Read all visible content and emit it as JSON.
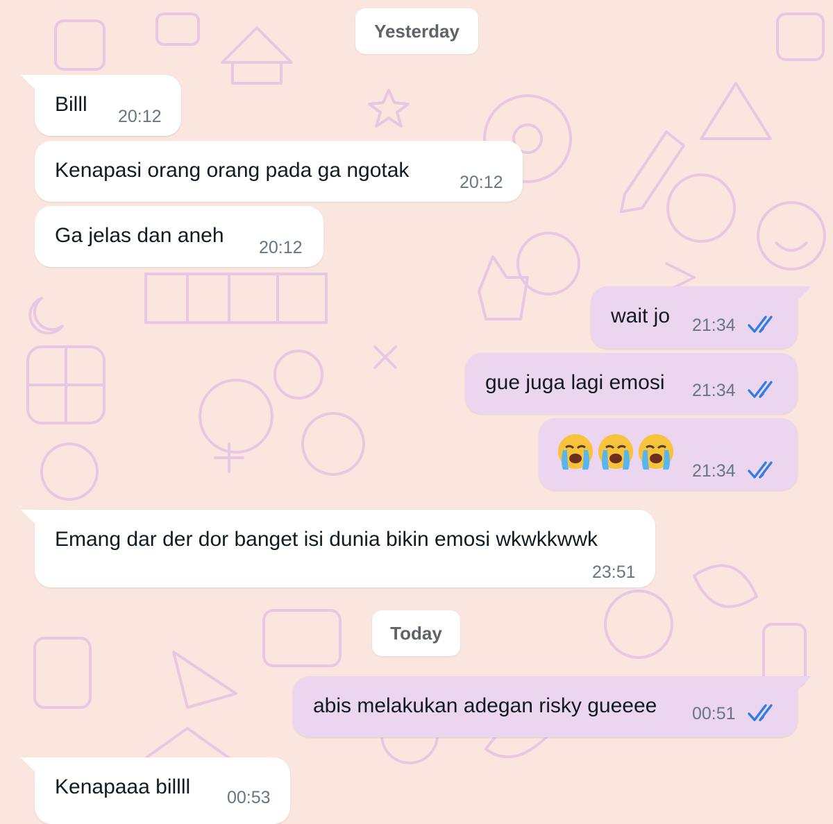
{
  "colors": {
    "background": "#fbe6df",
    "doodle": "#e7c7e3",
    "incoming_bubble": "#ffffff",
    "outgoing_bubble": "#ecd5ee",
    "timestamp": "#667781",
    "read_ticks": "#2f7de1"
  },
  "date_separators": {
    "yesterday": "Yesterday",
    "today": "Today"
  },
  "messages": [
    {
      "direction": "incoming",
      "text": "Billl",
      "time": "20:12"
    },
    {
      "direction": "incoming",
      "text": "Kenapasi orang orang pada ga ngotak",
      "time": "20:12"
    },
    {
      "direction": "incoming",
      "text": "Ga jelas dan aneh",
      "time": "20:12"
    },
    {
      "direction": "outgoing",
      "text": "wait jo",
      "time": "21:34",
      "status_icon": "double-check-read-icon"
    },
    {
      "direction": "outgoing",
      "text": "gue juga lagi emosi",
      "time": "21:34",
      "status_icon": "double-check-read-icon"
    },
    {
      "direction": "outgoing",
      "emoji": [
        "loudly-crying-face",
        "loudly-crying-face",
        "loudly-crying-face"
      ],
      "time": "21:34",
      "status_icon": "double-check-read-icon"
    },
    {
      "direction": "incoming",
      "text": "Emang dar der dor banget isi dunia bikin emosi wkwkkwwk",
      "time": "23:51"
    },
    {
      "direction": "outgoing",
      "text": "abis melakukan adegan risky gueeee",
      "time": "00:51",
      "status_icon": "double-check-read-icon"
    },
    {
      "direction": "incoming",
      "text": "Kenapaaa billll",
      "time": "00:53"
    }
  ]
}
